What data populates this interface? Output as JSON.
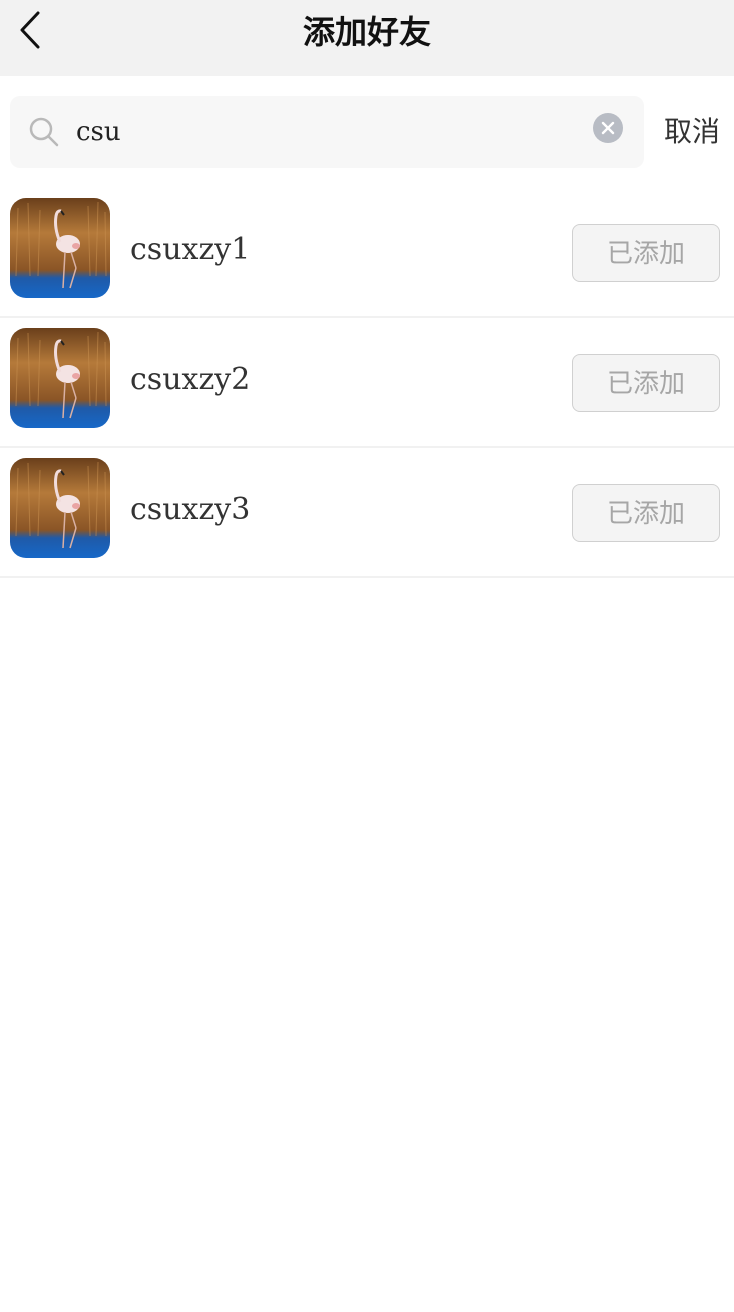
{
  "header": {
    "title": "添加好友",
    "back_icon": "chevron-left-icon"
  },
  "search": {
    "value": "csu",
    "placeholder": "",
    "search_icon": "search-icon",
    "clear_icon": "close-circle-icon",
    "cancel_label": "取消"
  },
  "results": [
    {
      "username": "csuxzy1",
      "status_label": "已添加",
      "avatar": "flamingo-avatar"
    },
    {
      "username": "csuxzy2",
      "status_label": "已添加",
      "avatar": "flamingo-avatar"
    },
    {
      "username": "csuxzy3",
      "status_label": "已添加",
      "avatar": "flamingo-avatar"
    }
  ],
  "colors": {
    "header_bg": "#f2f2f2",
    "search_bg": "#f7f7f7",
    "button_bg": "#f4f4f4",
    "button_text": "#a6a6a6",
    "clear_icon": "#b8bcc4"
  }
}
